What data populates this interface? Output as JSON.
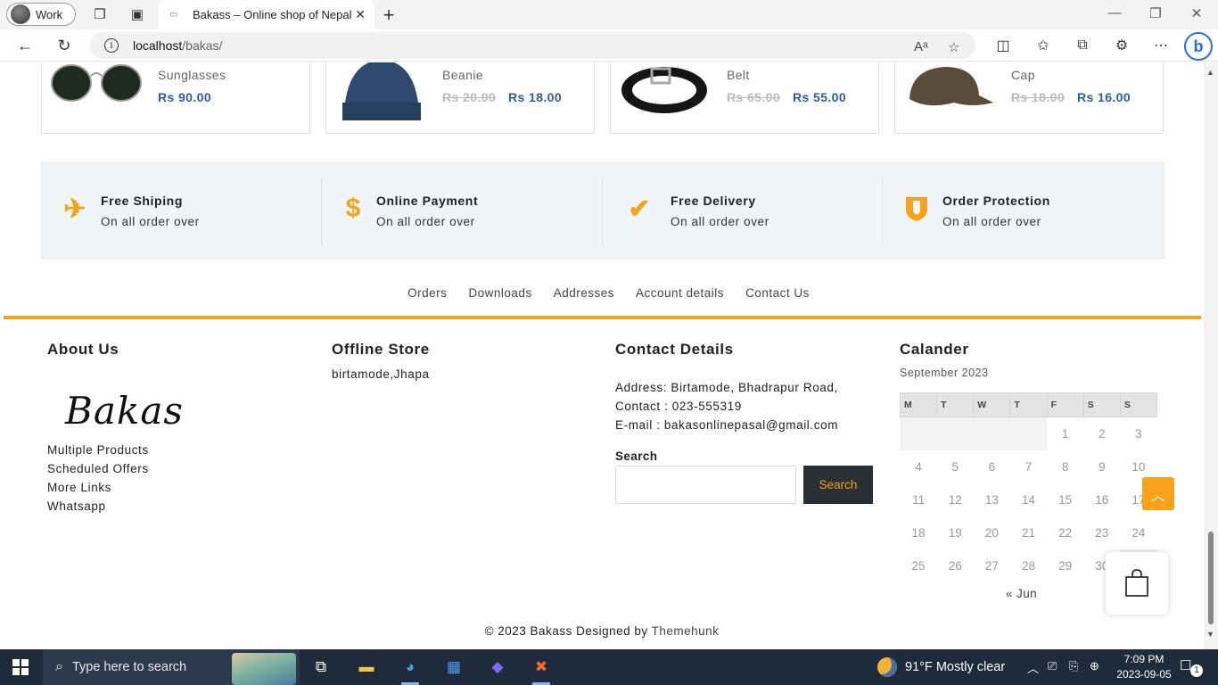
{
  "browser": {
    "profile_label": "Work",
    "tab_title": "Bakass – Online shop of Nepal",
    "url_host": "localhost",
    "url_path": "/bakas/"
  },
  "products": [
    {
      "name": "Sunglasses",
      "old_price": "",
      "price": "Rs 90.00",
      "image_icon": "sunglasses-image"
    },
    {
      "name": "Beanie",
      "old_price": "Rs 20.00",
      "price": "Rs 18.00",
      "image_icon": "beanie-image"
    },
    {
      "name": "Belt",
      "old_price": "Rs 65.00",
      "price": "Rs 55.00",
      "image_icon": "belt-image"
    },
    {
      "name": "Cap",
      "old_price": "Rs 18.00",
      "price": "Rs 16.00",
      "image_icon": "cap-image"
    }
  ],
  "features": [
    {
      "title": "Free Shiping",
      "subtitle": "On all order over",
      "icon": "plane-icon"
    },
    {
      "title": "Online Payment",
      "subtitle": "On all order over",
      "icon": "dollar-icon"
    },
    {
      "title": "Free Delivery",
      "subtitle": "On all order over",
      "icon": "checkmark-icon"
    },
    {
      "title": "Order Protection",
      "subtitle": "On all order over",
      "icon": "shield-icon"
    }
  ],
  "account_links": [
    "Orders",
    "Downloads",
    "Addresses",
    "Account details",
    "Contact Us"
  ],
  "footer": {
    "about": {
      "title": "About Us",
      "logo_text": "Bakas",
      "links": [
        "Multiple Products",
        "Scheduled Offers",
        "More Links",
        "Whatsapp"
      ]
    },
    "store": {
      "title": "Offline Store",
      "address": "birtamode,Jhapa"
    },
    "contact": {
      "title": "Contact Details",
      "address": "Address:  Birtamode, Bhadrapur Road,",
      "phone": "Contact : 023-555319",
      "email": "E-mail : bakasonlinepasal@gmail.com",
      "search_label": "Search",
      "search_button": "Search"
    },
    "calendar": {
      "title": "Calander",
      "caption": "September 2023",
      "weekdays": [
        "M",
        "T",
        "W",
        "T",
        "F",
        "S",
        "S"
      ],
      "weeks": [
        [
          "",
          "",
          "",
          "",
          "1",
          "2",
          "3"
        ],
        [
          "4",
          "5",
          "6",
          "7",
          "8",
          "9",
          "10"
        ],
        [
          "11",
          "12",
          "13",
          "14",
          "15",
          "16",
          "17"
        ],
        [
          "18",
          "19",
          "20",
          "21",
          "22",
          "23",
          "24"
        ],
        [
          "25",
          "26",
          "27",
          "28",
          "29",
          "30",
          ""
        ]
      ],
      "prev_link": "« Jun"
    },
    "copyright_prefix": "© 2023 Bakass Designed by ",
    "copyright_link": "Themehunk"
  },
  "taskbar": {
    "search_placeholder": "Type here to search",
    "weather": "91°F  Mostly clear",
    "time": "7:09 PM",
    "date": "2023-09-05",
    "notification_count": "1"
  },
  "colors": {
    "accent": "#f2a51a",
    "price": "#2d5f9a",
    "button_bg": "#2b2f33"
  }
}
